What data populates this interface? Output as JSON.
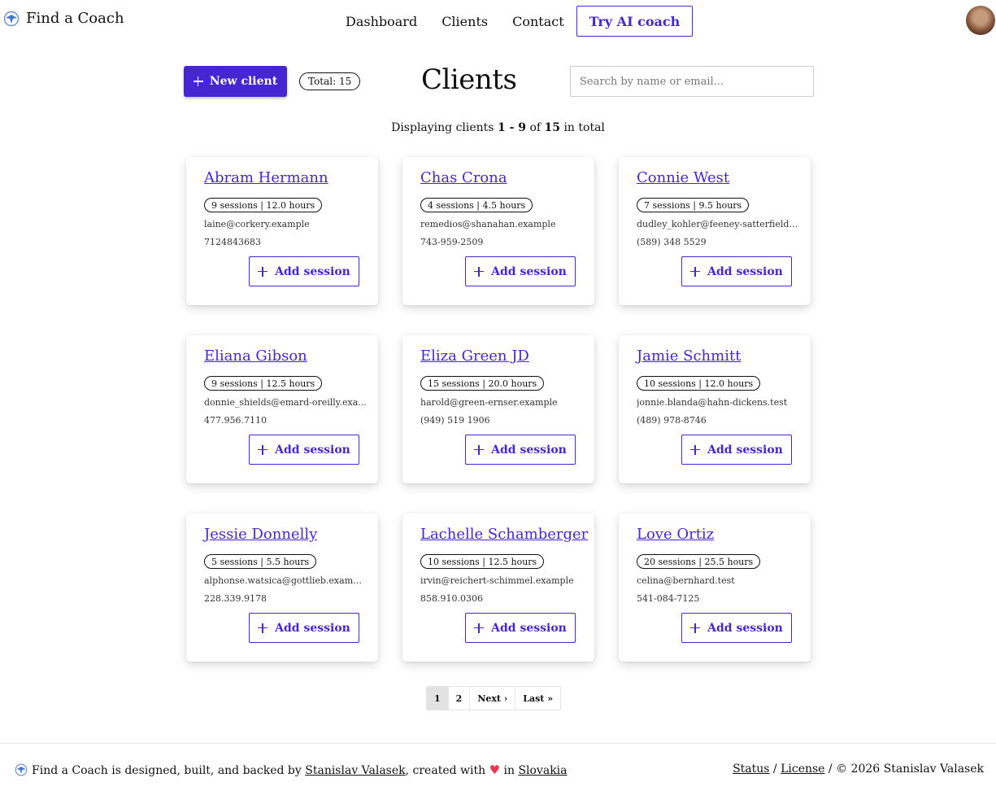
{
  "navbar": {
    "brand": "Find a Coach",
    "links": [
      "Dashboard",
      "Clients",
      "Contact"
    ],
    "try_ai": "Try AI coach"
  },
  "header": {
    "new_client": "New client",
    "total": "Total: 15",
    "title": "Clients",
    "search_placeholder": "Search by name or email..."
  },
  "summary": {
    "prefix": "Displaying clients ",
    "range": "1 - 9",
    "of": " of ",
    "total": "15",
    "suffix": " in total"
  },
  "add_session_label": "Add session",
  "clients": [
    {
      "name": "Abram Hermann",
      "stats": "9 sessions | 12.0 hours",
      "email": "laine@corkery.example",
      "phone": "7124843683"
    },
    {
      "name": "Chas Crona",
      "stats": "4 sessions | 4.5 hours",
      "email": "remedios@shanahan.example",
      "phone": "743-959-2509"
    },
    {
      "name": "Connie West",
      "stats": "7 sessions | 9.5 hours",
      "email": "dudley_kohler@feeney-satterfield.test",
      "phone": "(589) 348 5529"
    },
    {
      "name": "Eliana Gibson",
      "stats": "9 sessions | 12.5 hours",
      "email": "donnie_shields@emard-oreilly.exa...",
      "phone": "477.956.7110"
    },
    {
      "name": "Eliza Green JD",
      "stats": "15 sessions | 20.0 hours",
      "email": "harold@green-ernser.example",
      "phone": "(949) 519 1906"
    },
    {
      "name": "Jamie Schmitt",
      "stats": "10 sessions | 12.0 hours",
      "email": "jonnie.blanda@hahn-dickens.test",
      "phone": "(489) 978-8746"
    },
    {
      "name": "Jessie Donnelly",
      "stats": "5 sessions | 5.5 hours",
      "email": "alphonse.watsica@gottlieb.example",
      "phone": "228.339.9178"
    },
    {
      "name": "Lachelle Schamberger",
      "stats": "10 sessions | 12.5 hours",
      "email": "irvin@reichert-schimmel.example",
      "phone": "858.910.0306"
    },
    {
      "name": "Love Ortiz",
      "stats": "20 sessions | 25.5 hours",
      "email": "celina@bernhard.test",
      "phone": "541-084-7125"
    }
  ],
  "pagination": {
    "pages": [
      "1",
      "2"
    ],
    "current": "1",
    "next": "Next ›",
    "last": "Last »"
  },
  "footer": {
    "brand": "Find a Coach",
    "text1": " is designed, built, and backed by ",
    "author_link": "Stanislav Valasek",
    "text2": ", created with ",
    "text3": " in ",
    "country_link": "Slovakia",
    "status_link": "Status",
    "sep": " / ",
    "license_link": "License",
    "copyright": " / © 2026 Stanislav Valasek"
  },
  "colors": {
    "accent": "#4427d0",
    "heart": "#e63950"
  },
  "icons": {
    "brand_logo": "compass-logo-icon",
    "plus": "plus-icon",
    "heart": "heart-icon"
  }
}
